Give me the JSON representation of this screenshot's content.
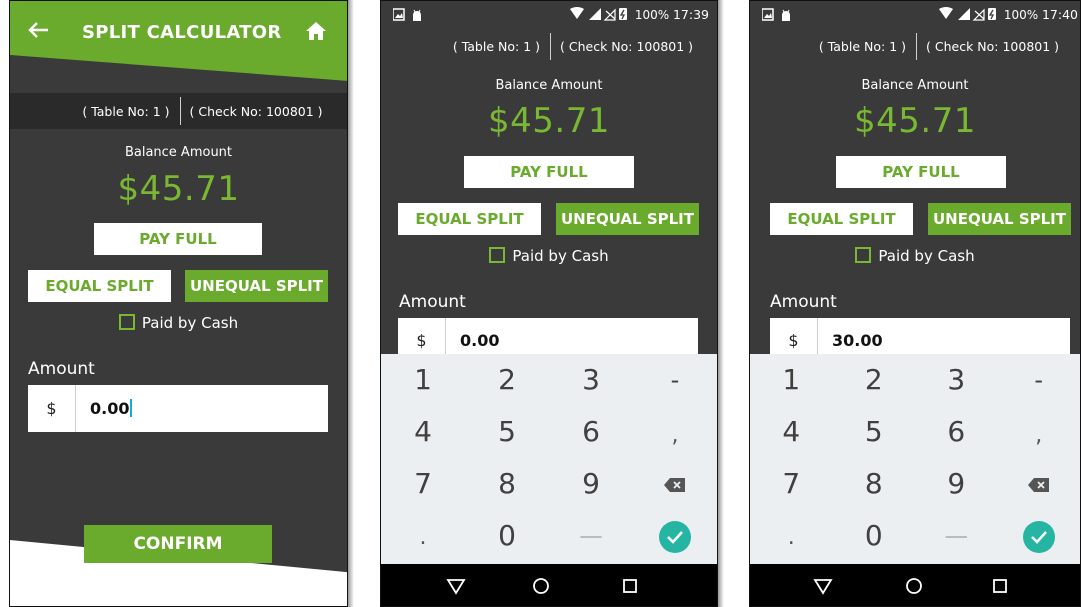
{
  "screen1": {
    "title": "SPLIT CALCULATOR",
    "table_no": "( Table No: 1 )",
    "check_no": "( Check No: 100801 )",
    "balance_label": "Balance Amount",
    "balance_amount": "$45.71",
    "pay_full": "PAY FULL",
    "equal_split": "EQUAL SPLIT",
    "unequal_split": "UNEQUAL SPLIT",
    "paid_by_cash": "Paid by Cash",
    "amount_label": "Amount",
    "currency": "$",
    "amount_value": "0.00",
    "confirm": "CONFIRM"
  },
  "screen2": {
    "status": {
      "battery": "100%",
      "time": "17:39"
    },
    "table_no": "( Table No: 1 )",
    "check_no": "( Check No: 100801 )",
    "balance_label": "Balance Amount",
    "balance_amount": "$45.71",
    "pay_full": "PAY FULL",
    "equal_split": "EQUAL SPLIT",
    "unequal_split": "UNEQUAL SPLIT",
    "paid_by_cash": "Paid by Cash",
    "amount_label": "Amount",
    "currency": "$",
    "amount_value": "0.00"
  },
  "screen3": {
    "status": {
      "battery": "100%",
      "time": "17:40"
    },
    "table_no": "( Table No: 1 )",
    "check_no": "( Check No: 100801 )",
    "balance_label": "Balance Amount",
    "balance_amount": "$45.71",
    "pay_full": "PAY FULL",
    "equal_split": "EQUAL SPLIT",
    "unequal_split": "UNEQUAL SPLIT",
    "paid_by_cash": "Paid by Cash",
    "amount_label": "Amount",
    "currency": "$",
    "amount_value": "30.00"
  },
  "keypad": {
    "k1": "1",
    "k2": "2",
    "k3": "3",
    "kminus": "-",
    "k4": "4",
    "k5": "5",
    "k6": "6",
    "kcomma": ",",
    "k7": "7",
    "k8": "8",
    "k9": "9",
    "kdot": ".",
    "k0": "0",
    "kspace": "___"
  },
  "colors": {
    "accent": "#6aaa2d",
    "amount": "#7ab833",
    "background": "#3a3a3a",
    "keypad": "#eceff1",
    "done": "#26b5a2"
  },
  "icons": [
    "back-arrow-icon",
    "home-icon",
    "image-icon",
    "android-icon",
    "wifi-icon",
    "signal-icon",
    "no-sim-icon",
    "battery-icon",
    "backspace-icon",
    "check-icon",
    "nav-back-icon",
    "nav-home-icon",
    "nav-recents-icon"
  ]
}
